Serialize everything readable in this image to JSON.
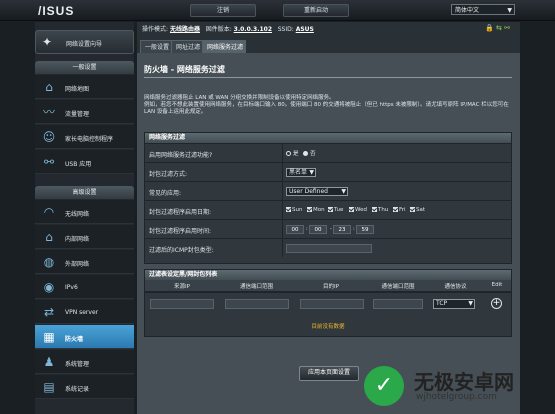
{
  "header": {
    "logo": "/ISUS",
    "logout": "注销",
    "reboot": "重新启动",
    "language": "简体中文"
  },
  "sidebar": {
    "wizard": "网络设置向导",
    "general_section": "一般设置",
    "general_items": [
      {
        "label": "网络地图",
        "icon": "network-map-icon"
      },
      {
        "label": "流量管理",
        "icon": "traffic-icon"
      },
      {
        "label": "家长电脑控制程序",
        "icon": "parental-icon"
      },
      {
        "label": "USB 应用",
        "icon": "usb-icon"
      }
    ],
    "advanced_section": "高级设置",
    "advanced_items": [
      {
        "label": "无线网络",
        "icon": "wifi-icon"
      },
      {
        "label": "内部网络",
        "icon": "home-icon"
      },
      {
        "label": "外部网络",
        "icon": "globe-icon"
      },
      {
        "label": "IPv6",
        "icon": "ipv6-icon"
      },
      {
        "label": "VPN server",
        "icon": "vpn-icon"
      },
      {
        "label": "防火墙",
        "icon": "firewall-icon",
        "active": true
      },
      {
        "label": "系统管理",
        "icon": "admin-icon"
      },
      {
        "label": "系统记录",
        "icon": "log-icon"
      }
    ]
  },
  "infobar": {
    "mode_label": "操作模式:",
    "mode_value": "无线路由器",
    "fw_label": "固件版本:",
    "fw_value": "3.0.0.3.102",
    "ssid_label": "SSID:",
    "ssid_value": "ASUS"
  },
  "tabs": [
    "一般设置",
    "网址过滤",
    "网络服务过滤"
  ],
  "page": {
    "title": "防火墙 - 网络服务过滤",
    "desc1": "网络服务过滤器阻止 LAN 或 WAN 分组交换并限制设备以使用特定网络服务。",
    "desc2": "例如，若您不想此装置使用网络服务，在目标端口输入 80。使用端口 80 的交通将被阻止（但已 https 未被限制）。请尤填写原阵 IP/MAC 栏以您可在 LAN 设备上运用此规定。"
  },
  "filter_table": {
    "header": "网络服务过滤",
    "rows": {
      "enable_label": "启用网络服务过滤功能?",
      "yes": "是",
      "no": "否",
      "method_label": "封包过滤方式:",
      "method_value": "黑名单",
      "apps_label": "常见的应用:",
      "apps_value": "User Defined",
      "days_label": "封包过滤程序启用日期:",
      "days": [
        "Sun",
        "Mon",
        "Tue",
        "Wed",
        "Thu",
        "Fri",
        "Sat"
      ],
      "time_label": "封包过滤程序启用时间:",
      "time": [
        "00",
        "00",
        "23",
        "59"
      ],
      "icmp_label": "过滤后的ICMP封包类型:"
    }
  },
  "list_table": {
    "header": "过滤表设定黑/网封包列表",
    "columns": [
      "来源IP",
      "通信端口范围",
      "目的IP",
      "通信端口范围",
      "通信协议",
      "Edit"
    ],
    "protocol_value": "TCP",
    "no_data": "目前没有数据"
  },
  "apply_button": "应用本页面设置",
  "watermark": {
    "title": "无极安卓网",
    "url": "wjhotelgroup.com"
  },
  "colors": {
    "active_nav": "#4aa3d8",
    "no_data": "#f0b429",
    "watermark_green": "#2aa84a"
  }
}
